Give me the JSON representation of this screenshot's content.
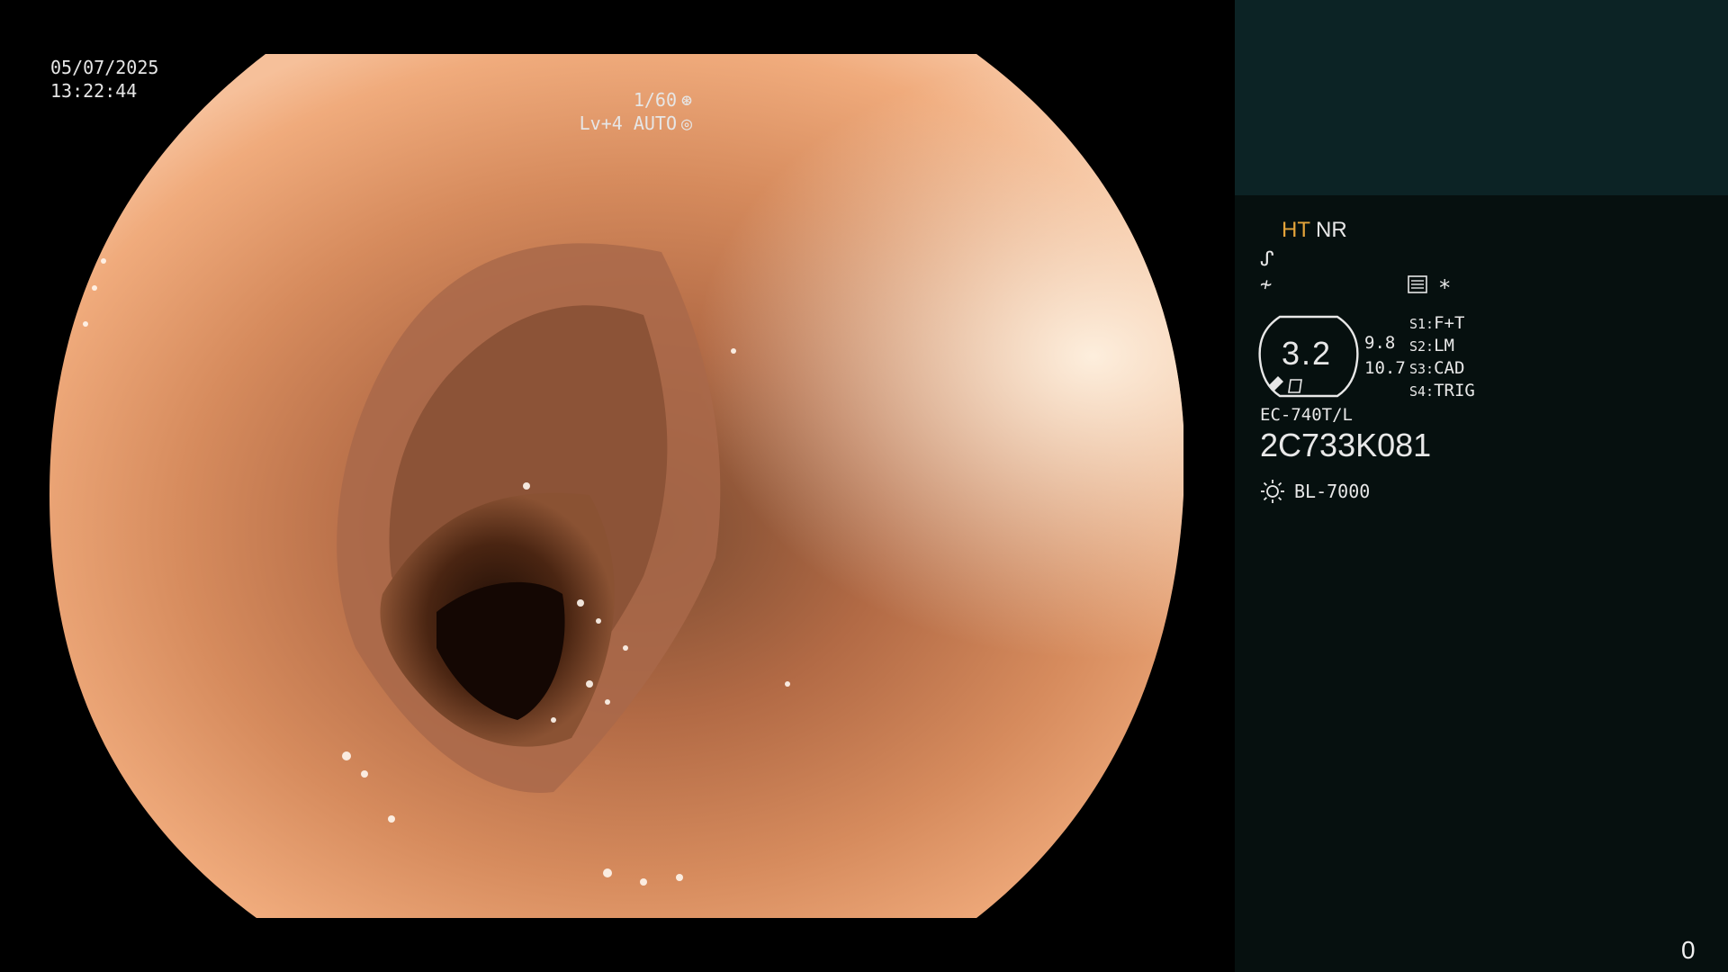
{
  "overlay": {
    "date": "05/07/2025",
    "time": "13:22:44",
    "shutter": "1/60",
    "level": "Lv+4 AUTO"
  },
  "panel": {
    "ht": "HT",
    "nr": "NR",
    "hex_value": "3.2",
    "value_a": "9.8",
    "value_b": "10.7",
    "slots": [
      {
        "key": "S1:",
        "value": "F+T"
      },
      {
        "key": "S2:",
        "value": "LM"
      },
      {
        "key": "S3:",
        "value": "CAD"
      },
      {
        "key": "S4:",
        "value": "TRIG"
      }
    ],
    "model": "EC-740T/L",
    "serial": "2C733K081",
    "lamp": "BL-7000",
    "counter": "0",
    "colors": {
      "accent": "#e4a43a",
      "panel_top": "#0c2325",
      "panel_bg": "#06100f"
    }
  }
}
